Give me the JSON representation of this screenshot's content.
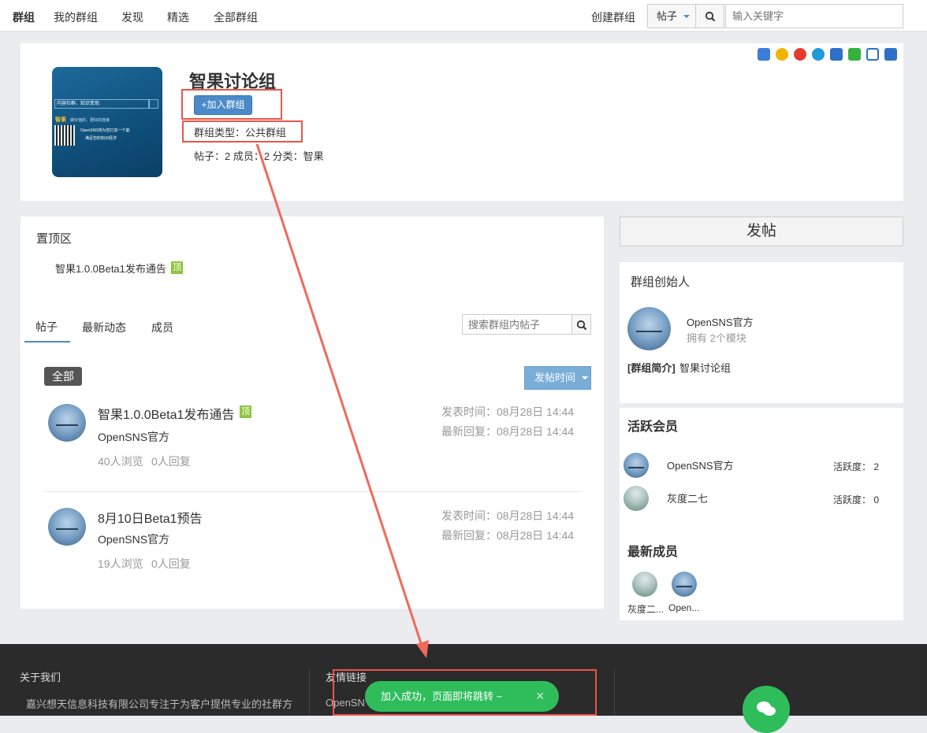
{
  "nav": {
    "brand": "群组",
    "items": [
      "我的群组",
      "发现",
      "精选",
      "全部群组"
    ],
    "create": "创建群组",
    "type_select": "帖子",
    "search_placeholder": "输入关键字"
  },
  "group": {
    "name": "智果讨论组",
    "join_label": "+加入群组",
    "type_text": "群组类型：公共群组",
    "stats_text": "帖子：2 成员：2 分类：智果",
    "cover": {
      "search_text": "内容社群、知识变现",
      "logo_text": "智果",
      "tagline": "做价值的、更好的连接",
      "desc1": "OpenSNS将为您打造一个能",
      "desc2": "满足您的知识经济"
    },
    "share_icons": [
      "qzone-share-icon",
      "favorite-share-icon",
      "weibo-share-icon",
      "pengyou-share-icon",
      "tieba-share-icon",
      "wechat-share-icon",
      "renren-share-icon",
      "copy-share-icon"
    ]
  },
  "pinned": {
    "title": "置顶区",
    "item": "智果1.0.0Beta1发布通告",
    "badge": "顶"
  },
  "tabs": [
    "帖子",
    "最新动态",
    "成员"
  ],
  "post_search_placeholder": "搜索群组内帖子",
  "filter": {
    "all_label": "全部",
    "sort_label": "发帖时间"
  },
  "posts": [
    {
      "title": "智果1.0.0Beta1发布通告",
      "badge": "顶",
      "author": "OpenSNS官方",
      "views": "40人浏览",
      "replies": "0人回复",
      "posted": "发表时间：08月28日 14:44",
      "last_reply": "最新回复：08月28日 14:44"
    },
    {
      "title": "8月10日Beta1预告",
      "badge": "",
      "author": "OpenSNS官方",
      "views": "19人浏览",
      "replies": "0人回复",
      "posted": "发表时间：08月28日 14:44",
      "last_reply": "最新回复：08月28日 14:44"
    }
  ],
  "sidebar": {
    "post_btn": "发帖",
    "founder_title": "群组创始人",
    "founder_name": "OpenSNS官方",
    "founder_modules": "拥有 2个模块",
    "intro_label": "[群组简介]",
    "intro_text": "智果讨论组",
    "active_title": "活跃会员",
    "active_members": [
      {
        "name": "OpenSNS官方",
        "activity": "活跃度： 2"
      },
      {
        "name": "灰度二七",
        "activity": "活跃度： 0"
      }
    ],
    "new_title": "最新成员",
    "new_members": [
      "灰度二...",
      "Open..."
    ]
  },
  "footer": {
    "about_title": "关于我们",
    "about_text": "嘉兴想天信息科技有限公司专注于为客户提供专业的社群方",
    "links_title": "友情链接",
    "link1": "OpenSN"
  },
  "toast": {
    "text": "加入成功，页面即将跳转 ~",
    "close": "×"
  },
  "colors": {
    "accent": "#4a8ac8",
    "success": "#2fbd5b",
    "annotation": "#e8564a",
    "footer": "#2b2b2b"
  }
}
